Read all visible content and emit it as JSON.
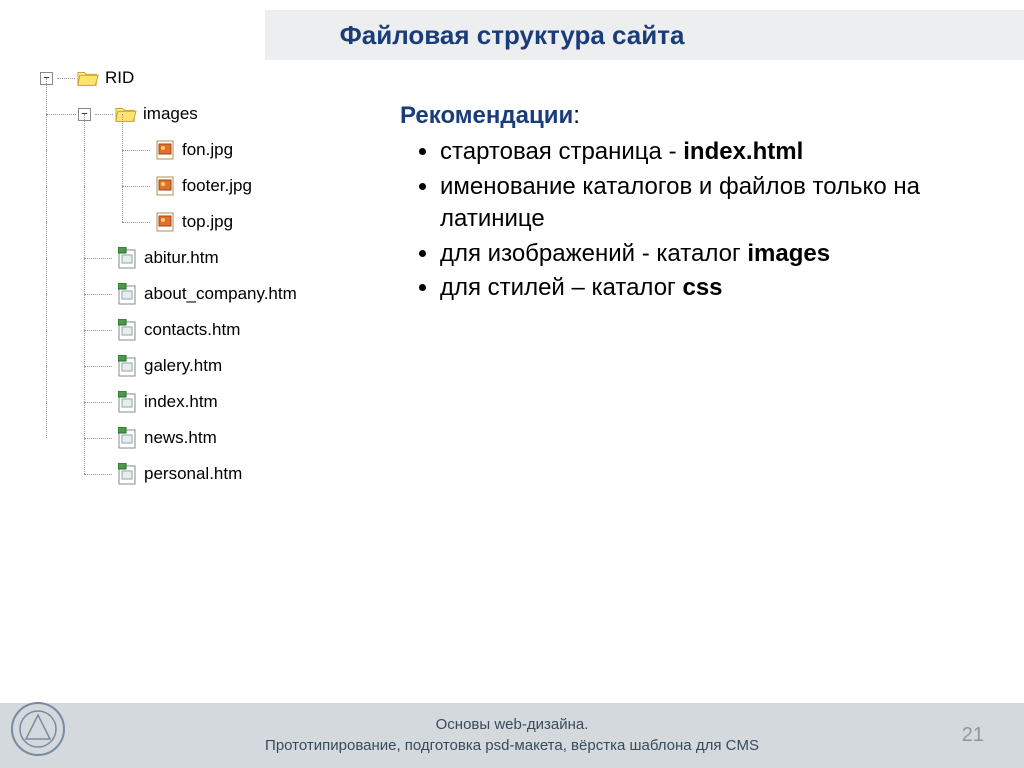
{
  "title": "Файловая структура сайта",
  "tree": {
    "root": "RID",
    "folder": "images",
    "images": [
      "fon.jpg",
      "footer.jpg",
      "top.jpg"
    ],
    "htm_files": [
      "abitur.htm",
      "about_company.htm",
      "contacts.htm",
      "galery.htm",
      "index.htm",
      "news.htm",
      "personal.htm"
    ]
  },
  "recs": {
    "heading": "Рекомендации",
    "colon": ":",
    "items": [
      {
        "pre": "стартовая страница - ",
        "bold": "index.html",
        "post": ""
      },
      {
        "pre": "именование каталогов и файлов только на латинице",
        "bold": "",
        "post": ""
      },
      {
        "pre": "для изображений - каталог ",
        "bold": "images",
        "post": ""
      },
      {
        "pre": "для стилей – каталог ",
        "bold": "css",
        "post": ""
      }
    ]
  },
  "footer": {
    "line1": "Основы web-дизайна.",
    "line2": "Прототипирование, подготовка psd-макета, вёрстка шаблона для CMS",
    "page": "21"
  },
  "glyphs": {
    "minus": "−"
  }
}
